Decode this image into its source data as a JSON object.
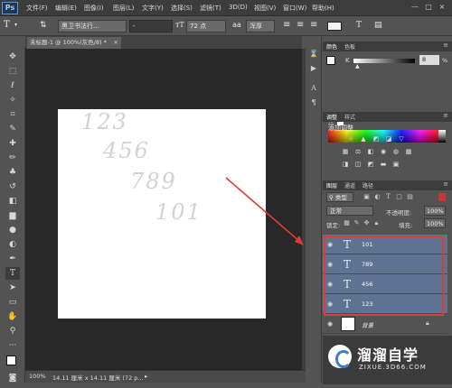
{
  "app": {
    "logo": "Ps"
  },
  "menu": [
    "文件(F)",
    "编辑(E)",
    "图像(I)",
    "图层(L)",
    "文字(Y)",
    "选择(S)",
    "滤镜(T)",
    "3D(D)",
    "视图(V)",
    "窗口(W)",
    "帮助(H)"
  ],
  "window_controls": {
    "minimize": "—",
    "maximize": "□",
    "close": "×"
  },
  "options": {
    "font_family": "黑卫书法行...",
    "font_style": "-",
    "font_size": "72 点",
    "antialias": "浑厚"
  },
  "document": {
    "tab_title": "未标题-1 @ 100%(灰色/8) *",
    "close": "×",
    "canvas_texts": [
      "123",
      "456",
      "789",
      "101"
    ]
  },
  "status": {
    "zoom": "100%",
    "info": "14.11 厘米 x 14.11 厘米 (72 p..."
  },
  "color_panel": {
    "tabs": [
      "颜色",
      "色板"
    ],
    "channel": "K",
    "value": "8",
    "unit": "%"
  },
  "adjust_panel": {
    "tabs": [
      "调整",
      "样式"
    ],
    "title": "添加调整",
    "icons": [
      "brightness-icon",
      "levels-icon",
      "curves-icon",
      "exposure-icon",
      "vibrance-icon",
      "hsl-icon",
      "color-balance-icon",
      "bw-icon",
      "photo-filter-icon",
      "channel-mixer-icon",
      "lookup-icon",
      "invert-icon",
      "posterize-icon",
      "threshold-icon",
      "gradient-map-icon",
      "selective-color-icon"
    ]
  },
  "layers_panel": {
    "tabs": [
      "图层",
      "通道",
      "路径"
    ],
    "filter_kind": "类型",
    "blend_mode": "正常",
    "opacity_label": "不透明度:",
    "opacity_value": "100%",
    "lock_label": "锁定:",
    "fill_label": "填充:",
    "fill_value": "100%",
    "layers": [
      {
        "name": "101",
        "type": "text"
      },
      {
        "name": "789",
        "type": "text"
      },
      {
        "name": "456",
        "type": "text"
      },
      {
        "name": "123",
        "type": "text"
      },
      {
        "name": "背景",
        "type": "background"
      }
    ]
  },
  "watermark": {
    "title": "溜溜自学",
    "subtitle": "ZIXUE.3D66.COM"
  },
  "colors": {
    "highlight": "#e03a3a",
    "selected_layer": "#5d7391",
    "arrow": "#e03a3a"
  }
}
